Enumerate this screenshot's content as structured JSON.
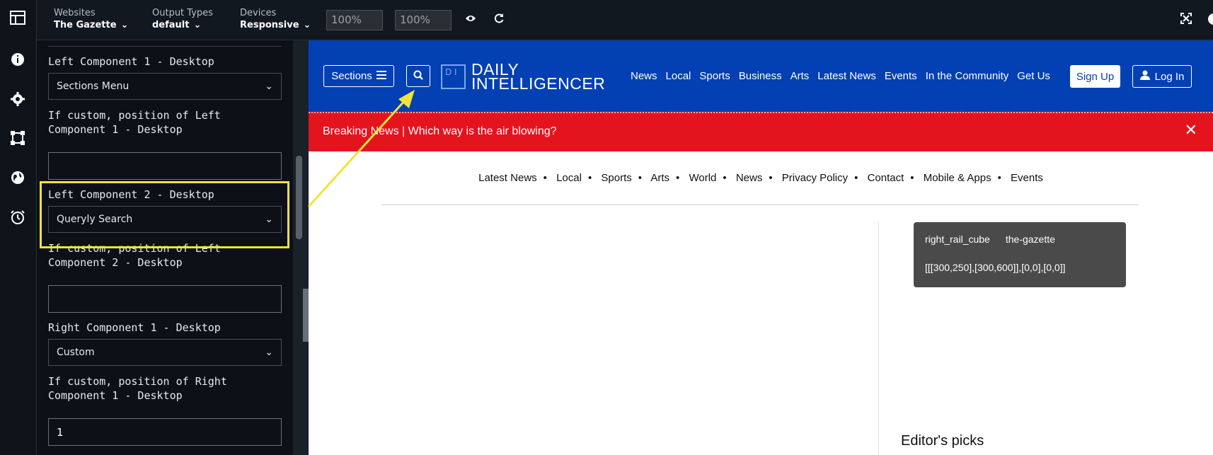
{
  "toolbar": {
    "websites_label": "Websites",
    "websites_value": "The Gazette",
    "output_label": "Output Types",
    "output_value": "default",
    "devices_label": "Devices",
    "devices_value": "Responsive",
    "width_value": "100%",
    "height_value": "100%",
    "times": "×"
  },
  "panel": {
    "fields": [
      {
        "label": "Left Component 1 - Desktop",
        "value": "Sections Menu"
      },
      {
        "label": "If custom, position of Left Component 1 - Desktop",
        "value": ""
      },
      {
        "label": "Left Component 2 - Desktop",
        "value": "Queryly Search"
      },
      {
        "label": "If custom, position of Left Component 2 - Desktop",
        "value": ""
      },
      {
        "label": "Right Component 1 - Desktop",
        "value": "Custom"
      },
      {
        "label": "If custom, position of Right Component 1 - Desktop",
        "value": "1"
      }
    ]
  },
  "preview": {
    "sections_label": "Sections",
    "logo_mark": "D I",
    "logo_line1": "DAILY",
    "logo_line2": "INTELLIGENCER",
    "nav": [
      "News",
      "Local",
      "Sports",
      "Business",
      "Arts",
      "Latest News",
      "Events",
      "In the Community",
      "Get Us"
    ],
    "signup": "Sign Up",
    "login": "Log In",
    "breaking": "Breaking News | Which way is the air blowing?",
    "subnav": [
      "Latest News",
      "Local",
      "Sports",
      "Arts",
      "World",
      "News",
      "Privacy Policy",
      "Contact",
      "Mobile & Apps",
      "Events"
    ],
    "ad_name": "right_rail_cube",
    "ad_site": "the-gazette",
    "ad_sizes": "[[[300,250],[300,600]],[0,0],[0,0]]",
    "editors_picks": "Editor's picks"
  },
  "colors": {
    "header_blue": "#0340b4",
    "breaking_red": "#e4141e",
    "highlight_yellow": "#f2e33a"
  }
}
